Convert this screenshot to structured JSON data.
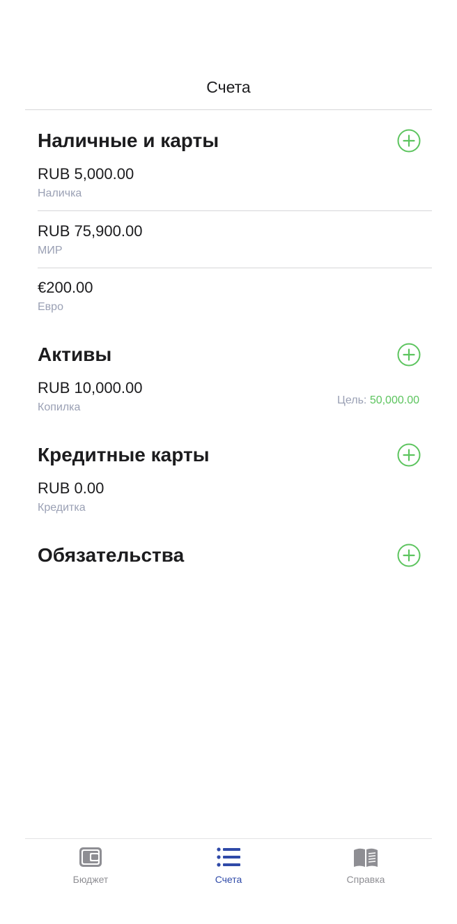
{
  "header": {
    "title": "Счета"
  },
  "colors": {
    "accent_green": "#5cc45e",
    "active_tab": "#2f4aa8",
    "inactive_tab": "#8e8e93",
    "secondary_text": "#9aa0b4"
  },
  "sections": [
    {
      "title": "Наличные и карты",
      "add_icon": "plus-circle-icon",
      "accounts": [
        {
          "amount": "RUB 5,000.00",
          "name": "Наличка"
        },
        {
          "amount": "RUB 75,900.00",
          "name": "МИР"
        },
        {
          "amount": "€200.00",
          "name": "Евро"
        }
      ]
    },
    {
      "title": "Активы",
      "add_icon": "plus-circle-icon",
      "accounts": [
        {
          "amount": "RUB 10,000.00",
          "name": "Копилка",
          "goal_label": "Цель:",
          "goal_value": "50,000.00"
        }
      ]
    },
    {
      "title": "Кредитные карты",
      "add_icon": "plus-circle-icon",
      "accounts": [
        {
          "amount": "RUB 0.00",
          "name": "Кредитка"
        }
      ]
    },
    {
      "title": "Обязательства",
      "add_icon": "plus-circle-icon",
      "accounts": []
    }
  ],
  "tabbar": {
    "tabs": [
      {
        "label": "Бюджет",
        "icon": "wallet-icon",
        "active": false
      },
      {
        "label": "Счета",
        "icon": "list-icon",
        "active": true
      },
      {
        "label": "Справка",
        "icon": "book-icon",
        "active": false
      }
    ]
  }
}
